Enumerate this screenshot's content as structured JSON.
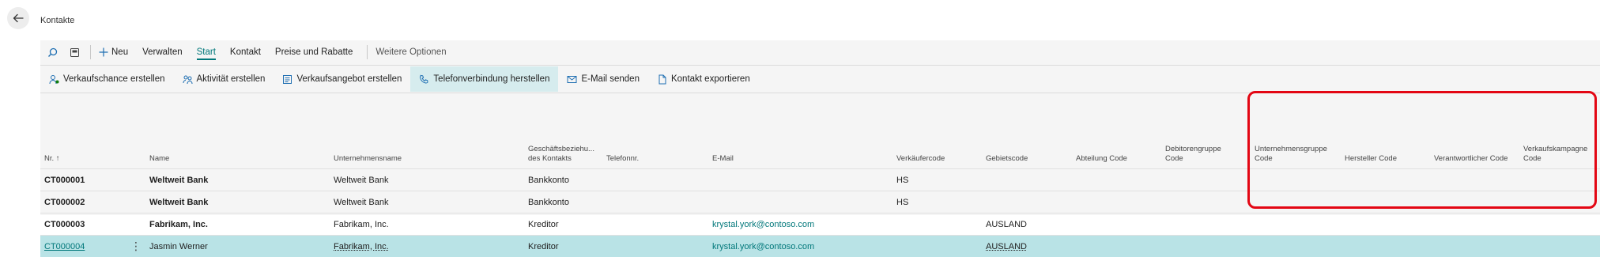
{
  "page": {
    "title": "Kontakte"
  },
  "actionbar": {
    "items": [
      {
        "label": "Neu"
      },
      {
        "label": "Verwalten"
      },
      {
        "label": "Start"
      },
      {
        "label": "Kontakt"
      },
      {
        "label": "Preise und Rabatte"
      },
      {
        "label": "Weitere Optionen"
      }
    ]
  },
  "subbar": {
    "items": [
      {
        "label": "Verkaufschance erstellen"
      },
      {
        "label": "Aktivität erstellen"
      },
      {
        "label": "Verkaufsangebot erstellen"
      },
      {
        "label": "Telefonverbindung herstellen"
      },
      {
        "label": "E-Mail senden"
      },
      {
        "label": "Kontakt exportieren"
      }
    ]
  },
  "columns": {
    "no": "Nr. ↑",
    "name": "Name",
    "company": "Unternehmensname",
    "relation_1": "Geschäftsbeziehu...",
    "relation_2": "des Kontakts",
    "phone": "Telefonnr.",
    "email": "E-Mail",
    "salesperson": "Verkäufercode",
    "territory": "Gebietscode",
    "department": "Abteilung Code",
    "customer_group_1": "Debitorengruppe",
    "customer_group_2": "Code",
    "company_group_1": "Unternehmensgruppe",
    "company_group_2": "Code",
    "manufacturer": "Hersteller Code",
    "responsible": "Verantwortlicher Code",
    "campaign_1": "Verkaufskampagne",
    "campaign_2": "Code"
  },
  "rows": [
    {
      "no": "CT000001",
      "name": "Weltweit Bank",
      "company": "Weltweit Bank",
      "relation": "Bankkonto",
      "email": "",
      "salesperson": "HS",
      "territory": ""
    },
    {
      "no": "CT000002",
      "name": "Weltweit Bank",
      "company": "Weltweit Bank",
      "relation": "Bankkonto",
      "email": "",
      "salesperson": "HS",
      "territory": ""
    },
    {
      "no": "CT000003",
      "name": "Fabrikam, Inc.",
      "company": "Fabrikam, Inc.",
      "relation": "Kreditor",
      "email": "krystal.york@contoso.com",
      "salesperson": "",
      "territory": "AUSLAND"
    },
    {
      "no": "CT000004",
      "name": "Jasmin Werner",
      "company": "Fabrikam, Inc.",
      "relation": "Kreditor",
      "email": "krystal.york@contoso.com",
      "salesperson": "",
      "territory": "AUSLAND",
      "more": "⋮"
    }
  ],
  "colors": {
    "accent": "#00777a",
    "selected_row": "#b9e3e6",
    "highlight": "#e30613"
  }
}
